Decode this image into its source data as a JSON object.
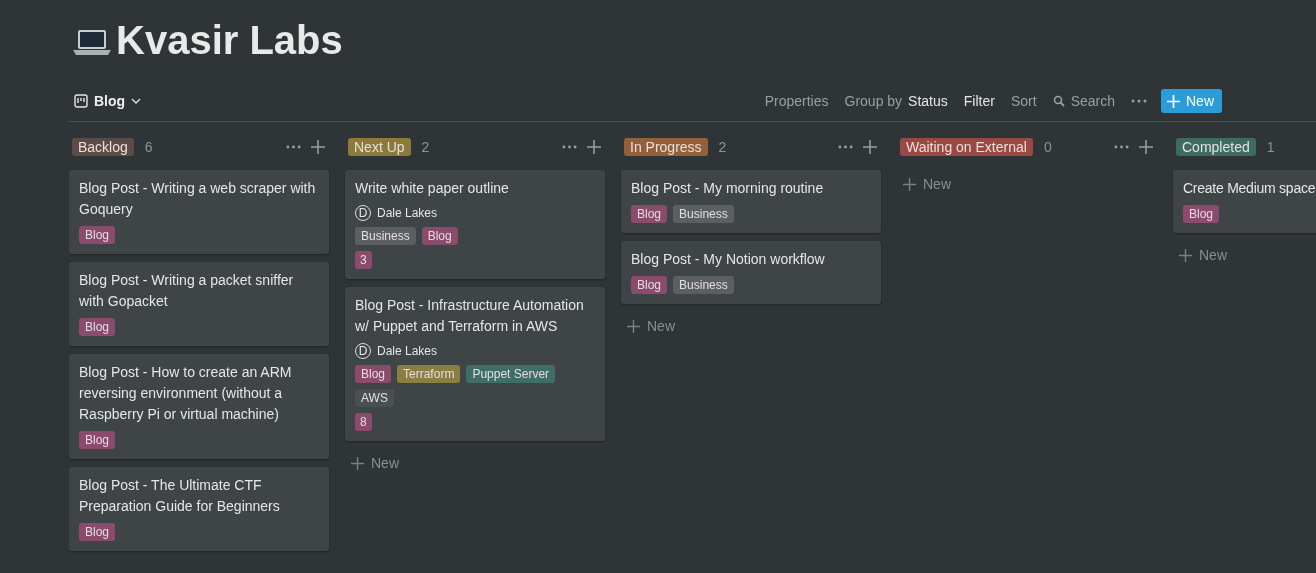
{
  "workspace_title": "Kvasir Labs",
  "view": {
    "name": "Blog"
  },
  "toolbar": {
    "properties": "Properties",
    "group_by_label": "Group by",
    "group_by_value": "Status",
    "filter": "Filter",
    "sort": "Sort",
    "search": "Search",
    "new_button": "New"
  },
  "columns": [
    {
      "name": "Backlog",
      "color": "#5c4b47",
      "count": "6",
      "cards": [
        {
          "title": "Blog Post - Writing a web scraper with Goquery",
          "tags": [
            {
              "label": "Blog",
              "color": "#8a4b6c"
            }
          ]
        },
        {
          "title": "Blog Post - Writing a packet sniffer with Gopacket",
          "tags": [
            {
              "label": "Blog",
              "color": "#8a4b6c"
            }
          ]
        },
        {
          "title": "Blog Post - How to create an ARM reversing environment (without a Raspberry Pi or virtual machine)",
          "tags": [
            {
              "label": "Blog",
              "color": "#8a4b6c"
            }
          ]
        },
        {
          "title": "Blog Post - The Ultimate CTF Preparation Guide for Beginners",
          "tags": [
            {
              "label": "Blog",
              "color": "#8a4b6c"
            }
          ]
        }
      ]
    },
    {
      "name": "Next Up",
      "color": "#8c7a3a",
      "count": "2",
      "new_label": "New",
      "cards": [
        {
          "title": "Write white paper outline",
          "assignee": {
            "initial": "D",
            "name": "Dale Lakes"
          },
          "tags": [
            {
              "label": "Business",
              "color": "#5b5f61"
            },
            {
              "label": "Blog",
              "color": "#8a4b6c"
            }
          ],
          "number": "3"
        },
        {
          "title": "Blog Post - Infrastructure Automation w/ Puppet and Terraform in AWS",
          "assignee": {
            "initial": "D",
            "name": "Dale Lakes"
          },
          "tags": [
            {
              "label": "Blog",
              "color": "#8a4b6c"
            },
            {
              "label": "Terraform",
              "color": "#8c7d42"
            },
            {
              "label": "Puppet Server",
              "color": "#3e6e66"
            },
            {
              "label": "AWS",
              "color": "#4a4f52"
            }
          ],
          "number": "8"
        }
      ]
    },
    {
      "name": "In Progress",
      "color": "#946039",
      "count": "2",
      "new_label": "New",
      "cards": [
        {
          "title": "Blog Post - My morning routine",
          "tags": [
            {
              "label": "Blog",
              "color": "#8a4b6c"
            },
            {
              "label": "Business",
              "color": "#5b5f61"
            }
          ]
        },
        {
          "title": "Blog Post - My Notion workflow",
          "tags": [
            {
              "label": "Blog",
              "color": "#8a4b6c"
            },
            {
              "label": "Business",
              "color": "#5b5f61"
            }
          ]
        }
      ]
    },
    {
      "name": "Waiting on External",
      "color": "#9a4843",
      "count": "0",
      "new_label": "New"
    },
    {
      "name": "Completed",
      "color": "#3d6b61",
      "count": "1",
      "new_label": "New",
      "cards": [
        {
          "title": "Create Medium space",
          "tags": [
            {
              "label": "Blog",
              "color": "#8a4b6c"
            }
          ]
        }
      ]
    }
  ]
}
